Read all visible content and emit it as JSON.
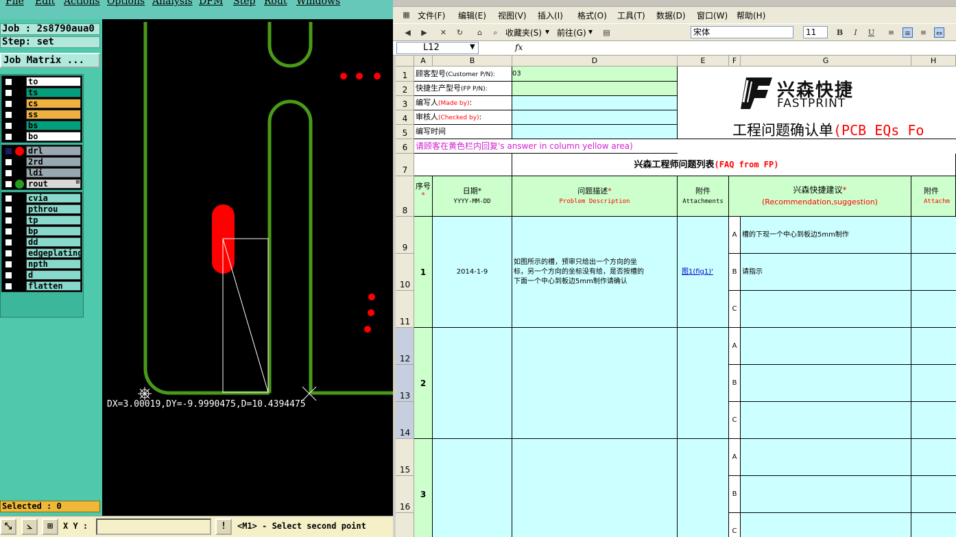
{
  "cam": {
    "menu": [
      "File",
      "Edit",
      "Actions",
      "Options",
      "Analysis",
      "DFM",
      "Step",
      "Rout",
      "Windows"
    ],
    "job_label": "Job : 2s8790aua0",
    "step_label": "Step: set",
    "job_matrix_button": "Job Matrix ...",
    "layer_groups": [
      [
        {
          "name": "to",
          "color": "#ffffff",
          "checked": false,
          "dot": null
        },
        {
          "name": "ts",
          "color": "#00a07c",
          "checked": false,
          "dot": null
        },
        {
          "name": "cs",
          "color": "#f0b040",
          "checked": false,
          "dot": null
        },
        {
          "name": "ss",
          "color": "#f0b040",
          "checked": false,
          "dot": null
        },
        {
          "name": "bs",
          "color": "#00a07c",
          "checked": false,
          "dot": null
        },
        {
          "name": "bo",
          "color": "#ffffff",
          "checked": false,
          "dot": null
        }
      ],
      [
        {
          "name": "drl",
          "color": "#98a8b0",
          "checked": true,
          "dot": "#ff0000"
        },
        {
          "name": "2rd",
          "color": "#98a8b0",
          "checked": false,
          "dot": null
        },
        {
          "name": "ldi",
          "color": "#98a8b0",
          "checked": false,
          "dot": null
        },
        {
          "name": "rout",
          "color": "#d8d8d8",
          "checked": false,
          "dot": "#2a9a20"
        }
      ],
      [
        {
          "name": "cvia",
          "color": "#88d8cc",
          "checked": false,
          "dot": null
        },
        {
          "name": "pthrou",
          "color": "#88d8cc",
          "checked": false,
          "dot": null
        },
        {
          "name": "tp",
          "color": "#88d8cc",
          "checked": false,
          "dot": null
        },
        {
          "name": "bp",
          "color": "#88d8cc",
          "checked": false,
          "dot": null
        },
        {
          "name": "dd",
          "color": "#88d8cc",
          "checked": false,
          "dot": null
        },
        {
          "name": "edgeplating",
          "color": "#88d8cc",
          "checked": false,
          "dot": null
        },
        {
          "name": "npth",
          "color": "#88d8cc",
          "checked": false,
          "dot": null
        },
        {
          "name": "d",
          "color": "#88d8cc",
          "checked": false,
          "dot": null
        },
        {
          "name": "flatten",
          "color": "#88d8cc",
          "checked": false,
          "dot": null
        }
      ]
    ],
    "rout_group_marker": "⊞",
    "selected_label": "Selected : 0",
    "measure_text": "DX=3.00019,DY=-9.9990475,D=10.4394475",
    "xy_label": "X Y :",
    "xy_value": "",
    "prompt_icon": "!",
    "prompt": "<M1> - Select second point"
  },
  "excel": {
    "menu": [
      "文件(F)",
      "编辑(E)",
      "视图(V)",
      "插入(I)",
      "格式(O)",
      "工具(T)",
      "数据(D)",
      "窗口(W)",
      "帮助(H)"
    ],
    "toolbar": {
      "favorites": "收藏夹(S)",
      "go": "前往(G)",
      "font_name": "宋体",
      "font_size": "11"
    },
    "name_box": "L12",
    "fx": "fx",
    "columns": [
      "A",
      "B",
      "D",
      "E",
      "F",
      "G",
      "H"
    ],
    "rows": [
      "1",
      "2",
      "3",
      "4",
      "5",
      "6",
      "7",
      "8",
      "9",
      "10",
      "11",
      "12",
      "13",
      "14",
      "15",
      "16"
    ],
    "header": {
      "customer_pn_label": "顾客型号",
      "customer_pn_en": "(Customer P/N):",
      "customer_pn_value": "03",
      "fp_pn_label": "快捷生产型号",
      "fp_pn_en": "(FP P/N):",
      "made_by_label": "编写人",
      "made_by_en": "(Made by)",
      "made_by_colon": ":",
      "checked_by_label": "审核人",
      "checked_by_en": "(Checked by)",
      "checked_by_colon": ":",
      "date_label": "编写时间",
      "note": "请顾客在黄色栏内回复",
      "note_en": "'s answer in column yellow area)",
      "logo_cn": "兴森快捷",
      "logo_en": "FASTPRINT",
      "doc_title_cn": "工程问题确认单",
      "doc_title_en": "(PCB EQs Fo",
      "faq_title_cn": "兴森工程师问题列表",
      "faq_title_en": "(FAQ from FP)"
    },
    "table_header": {
      "seq_cn": "序号",
      "seq_star": "*",
      "date_cn": "日期",
      "date_star": "*",
      "date_fmt": "YYYY-MM-DD",
      "problem_cn": "问题描述",
      "problem_star": "*",
      "problem_en": "Problem Description",
      "attach_cn": "附件",
      "attach_en": "Attachments",
      "rec_cn": "兴森快捷建议",
      "rec_star": "*",
      "rec_en": "(Recommendation,suggestion)",
      "attach2_cn": "附件",
      "attach2_en": "Attachm"
    },
    "items": [
      {
        "no": "1",
        "date": "2014-1-9",
        "problem_lines": [
          "如图所示的槽，预审只给出一个方向的坐",
          "标，另一个方向的坐标没有给，是否按槽的",
          "下面一个中心到板边5mm制作请确认"
        ],
        "attachment": "图1(fig1)'",
        "options": [
          {
            "letter": "A",
            "text": "槽的下现一个中心到板边5mm制作"
          },
          {
            "letter": "B",
            "text": "请指示"
          },
          {
            "letter": "C",
            "text": ""
          }
        ]
      },
      {
        "no": "2",
        "date": "",
        "problem_lines": [],
        "attachment": "",
        "options": [
          {
            "letter": "A",
            "text": ""
          },
          {
            "letter": "B",
            "text": ""
          },
          {
            "letter": "C",
            "text": ""
          }
        ]
      },
      {
        "no": "3",
        "date": "",
        "problem_lines": [],
        "attachment": "",
        "options": [
          {
            "letter": "A",
            "text": ""
          },
          {
            "letter": "B",
            "text": ""
          },
          {
            "letter": "C",
            "text": ""
          }
        ]
      }
    ]
  }
}
